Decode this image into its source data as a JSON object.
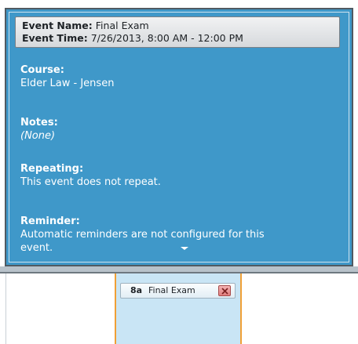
{
  "popup": {
    "header": {
      "event_name_label": "Event Name:",
      "event_name_value": "Final Exam",
      "event_time_label": "Event Time:",
      "event_time_value": "7/26/2013, 8:00 AM - 12:00 PM"
    },
    "course": {
      "label": "Course:",
      "value": "Elder Law - Jensen"
    },
    "notes": {
      "label": "Notes:",
      "value": "(None)"
    },
    "repeating": {
      "label": "Repeating:",
      "value": "This event does not repeat."
    },
    "reminder": {
      "label": "Reminder:",
      "line1": "Automatic reminders are not configured for this",
      "line2": "event."
    },
    "scroll_indicator_icon": "caret-down-icon"
  },
  "calendar": {
    "event_chip": {
      "time": "8a",
      "title": "Final Exam",
      "close_icon": "close-icon"
    }
  },
  "colors": {
    "popup_bg": "#3f98c9",
    "selected_column": "#c9e5f5",
    "selected_border": "#f0a036"
  }
}
